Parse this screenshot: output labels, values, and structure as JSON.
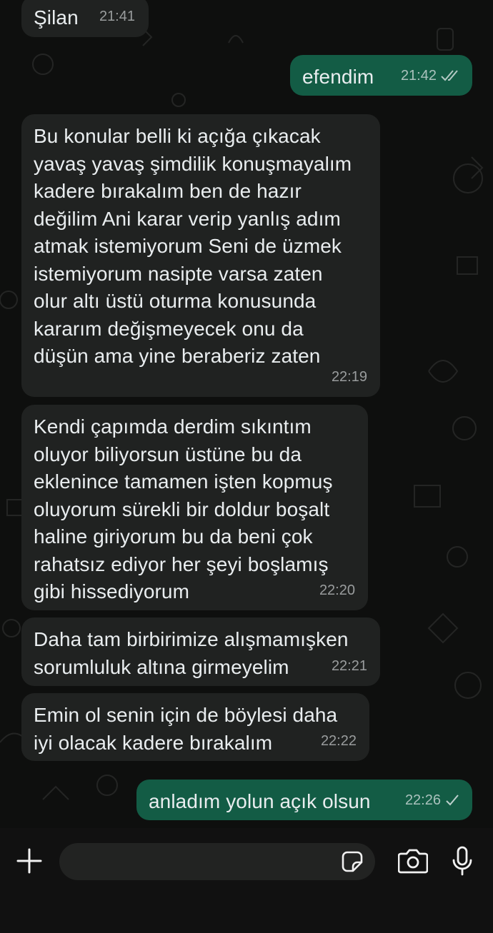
{
  "messages": [
    {
      "id": "m1",
      "direction": "incoming",
      "text": "Şilan",
      "time": "21:41"
    },
    {
      "id": "m2",
      "direction": "outgoing",
      "text": "efendim",
      "time": "21:42",
      "status": "read"
    },
    {
      "id": "m3",
      "direction": "incoming",
      "text": "Bu konular belli ki açığa çıkacak\nyavaş yavaş şimdilik konuşmayalım\nkadere bırakalım ben de hazır\ndeğilim Ani karar verip yanlış adım\natmak istemiyorum Seni de üzmek\nistemiyorum nasipte varsa zaten\nolur altı üstü oturma konusunda\nkararım değişmeyecek onu da\ndüşün ama yine beraberiz zaten",
      "time": "22:19"
    },
    {
      "id": "m4",
      "direction": "incoming",
      "text": "Kendi çapımda derdim sıkıntım\noluyor biliyorsun üstüne bu da\neklenince tamamen işten kopmuş\noluyorum sürekli bir doldur boşalt\nhaline giriyorum bu da beni çok\nrahatsız ediyor her şeyi boşlamış\ngibi hissediyorum",
      "time": "22:20"
    },
    {
      "id": "m5",
      "direction": "incoming",
      "text": "Daha tam birbirimize alışmamışken\nsorumluluk altına girmeyelim",
      "time": "22:21"
    },
    {
      "id": "m6",
      "direction": "incoming",
      "text": "Emin ol senin için de böylesi daha\niyi olacak kadere bırakalım",
      "time": "22:22"
    },
    {
      "id": "m7",
      "direction": "outgoing",
      "text": "anladım yolun açık olsun",
      "time": "22:26",
      "status": "sent"
    }
  ],
  "input_bar": {
    "icons": {
      "add": "plus-icon",
      "sticker": "sticker-icon",
      "camera": "camera-icon",
      "mic": "microphone-icon"
    },
    "message_value": ""
  },
  "colors": {
    "incoming_bubble": "#202221",
    "outgoing_bubble": "#135c45",
    "chat_background": "#0e0f0e",
    "input_bar": "#111111"
  }
}
